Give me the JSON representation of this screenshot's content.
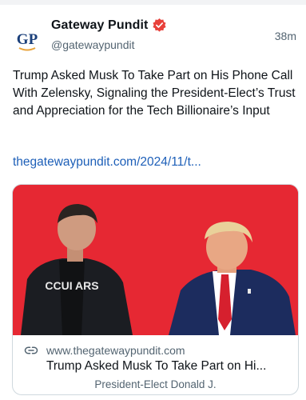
{
  "post": {
    "author_name": "Gateway Pundit",
    "author_handle": "@gatewaypundit",
    "avatar_text": "GP",
    "timestamp": "38m",
    "text": "Trump Asked Musk To Take Part on His Phone Call With Zelensky, Signaling the President-Elect’s Trust and Appreciation for the Tech Billionaire’s Input",
    "link": "thegatewaypundit.com/2024/11/t..."
  },
  "link_card": {
    "domain": "www.thegatewaypundit.com",
    "title": "Trump Asked Musk To Take Part on Hi...",
    "description": "President-Elect Donald J.",
    "shirt_text": "CCUI ARS"
  },
  "colors": {
    "brand_blue": "#1d5fb8",
    "verified_badge": "#e8413b",
    "image_background": "#e62833"
  },
  "icons": {
    "verified": "verified-badge-icon",
    "link": "link-icon"
  }
}
